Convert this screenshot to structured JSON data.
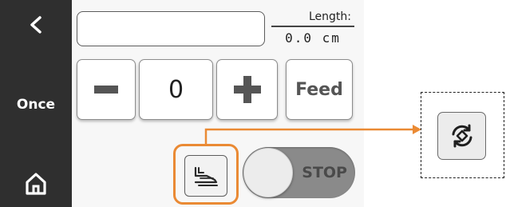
{
  "sidebar": {
    "back_icon": "chevron-left-icon",
    "mode_label": "Once",
    "home_icon": "home-icon"
  },
  "length": {
    "label": "Length:",
    "value": "0.0",
    "unit": "cm"
  },
  "controls": {
    "minus_icon": "minus-icon",
    "quantity": "0",
    "plus_icon": "plus-icon",
    "feed_label": "Feed"
  },
  "bottom": {
    "shoe_icon": "shoe-icon",
    "toggle_label": "STOP",
    "toggle_on": false
  },
  "callout": {
    "icon": "rotate-icon",
    "highlight_color": "#ea8a34"
  },
  "colors": {
    "sidebar": "#2f2f2f",
    "toggle_track": "#8a8a8a",
    "accent": "#ea8a34"
  }
}
